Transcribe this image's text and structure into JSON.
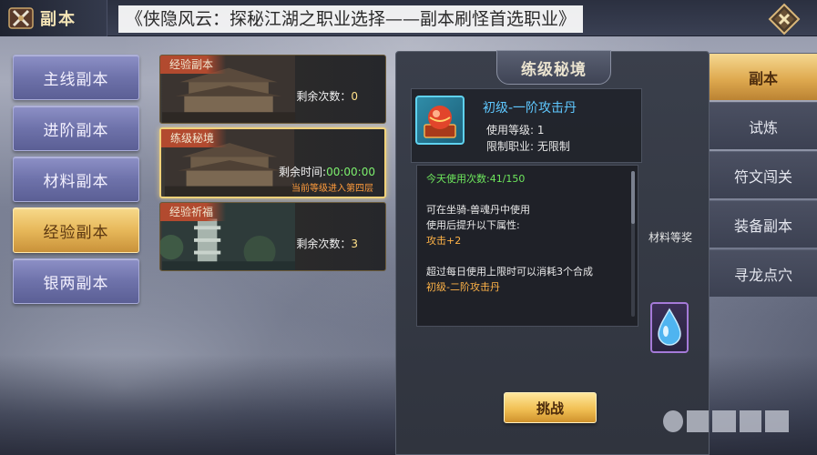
{
  "header": {
    "title": "副本",
    "title_icon": "crossed-swords-icon",
    "close_icon": "close-icon"
  },
  "banner": {
    "text": "《侠隐风云：探秘江湖之职业选择——副本刷怪首选职业》"
  },
  "left_nav": {
    "items": [
      {
        "label": "主线副本",
        "active": false
      },
      {
        "label": "进阶副本",
        "active": false
      },
      {
        "label": "材料副本",
        "active": false
      },
      {
        "label": "经验副本",
        "active": true
      },
      {
        "label": "银两副本",
        "active": false
      }
    ]
  },
  "dungeons": [
    {
      "name": "经验副本",
      "stat_label": "剩余次数：",
      "stat_value": "0",
      "selected": false
    },
    {
      "name": "练级秘境",
      "stat_label": "剩余时间:",
      "stat_value": "00:00:00",
      "note": "当前等级进入第四层",
      "selected": true
    },
    {
      "name": "经验祈福",
      "stat_label": "剩余次数：",
      "stat_value": "3",
      "selected": false
    }
  ],
  "panel": {
    "title": "练级秘境",
    "item": {
      "name": "初级-一阶攻击丹",
      "use_level": "使用等级: 1",
      "restriction": "限制职业: 无限制",
      "icon": "red-orb-on-chest-icon"
    },
    "description": {
      "today_usage": "今天使用次数:41/150",
      "line1": "可在坐骑-兽魂丹中使用",
      "line2": "使用后提升以下属性:",
      "line3": "攻击+2",
      "line4": "超过每日使用上限时可以消耗3个合成",
      "line5": "初级-二阶攻击丹"
    },
    "side_text": "材料等奖",
    "challenge_label": "挑战",
    "crystal_icon": "water-drop-crystal-icon"
  },
  "right_nav": {
    "items": [
      {
        "label": "副本",
        "active": true
      },
      {
        "label": "试炼",
        "active": false
      },
      {
        "label": "符文闯关",
        "active": false
      },
      {
        "label": "装备副本",
        "active": false
      },
      {
        "label": "寻龙点穴",
        "active": false
      }
    ]
  },
  "colors": {
    "accent_gold": "#f1c054",
    "nav_purple": "#6e72aa",
    "item_name_blue": "#5fc8ff",
    "usage_green": "#6ee85d",
    "note_orange": "#ff9b3b"
  }
}
